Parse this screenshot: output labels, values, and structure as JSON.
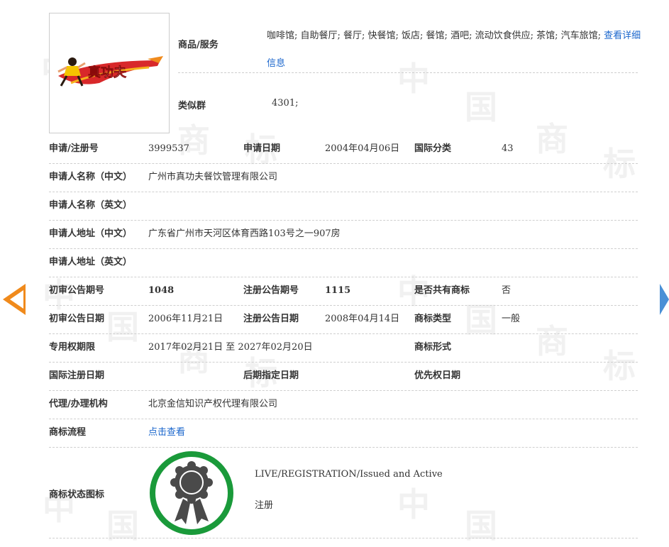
{
  "mark_image": {
    "text": "真功夫"
  },
  "goods": {
    "label": "商品/服务",
    "text": "咖啡馆; 自助餐厅; 餐厅; 快餐馆; 饭店; 餐馆; 酒吧; 流动饮食供应; 茶馆; 汽车旅馆;",
    "link": "查看详细信息"
  },
  "similar": {
    "label": "类似群",
    "value": "4301;"
  },
  "rows": {
    "reg": {
      "l1": "申请/注册号",
      "v1": "3999537",
      "l2": "申请日期",
      "v2": "2004年04月06日",
      "l3": "国际分类",
      "v3": "43"
    },
    "name_cn": {
      "l1": "申请人名称（中文）",
      "v1": "广州市真功夫餐饮管理有限公司"
    },
    "name_en": {
      "l1": "申请人名称（英文）",
      "v1": ""
    },
    "addr_cn": {
      "l1": "申请人地址（中文）",
      "v1": "广东省广州市天河区体育西路103号之一907房"
    },
    "addr_en": {
      "l1": "申请人地址（英文）",
      "v1": ""
    },
    "pub_no": {
      "l1": "初审公告期号",
      "v1": "1048",
      "l2": "注册公告期号",
      "v2": "1115",
      "l3": "是否共有商标",
      "v3": "否"
    },
    "pub_date": {
      "l1": "初审公告日期",
      "v1": "2006年11月21日",
      "l2": "注册公告日期",
      "v2": "2008年04月14日",
      "l3": "商标类型",
      "v3": "一般"
    },
    "term": {
      "l1": "专用权期限",
      "v1": "2017年02月21日 至 2027年02月20日",
      "l3": "商标形式",
      "v3": ""
    },
    "intl": {
      "l1": "国际注册日期",
      "v1": "",
      "l2": "后期指定日期",
      "v2": "",
      "l3": "优先权日期",
      "v3": ""
    },
    "agent": {
      "l1": "代理/办理机构",
      "v1": "北京金信知识产权代理有限公司"
    },
    "flow": {
      "l1": "商标流程",
      "v1": "点击查看"
    }
  },
  "status": {
    "label": "商标状态图标",
    "en": "LIVE/REGISTRATION/Issued and Active",
    "cn": "注册",
    "ring_color": "#1a9a3a",
    "icon_color": "#4a4a4a"
  },
  "watermark": [
    "中",
    "国",
    "商",
    "标"
  ],
  "colors": {
    "link": "#1a66cc",
    "prev_arrow": "#f08a1c",
    "next_arrow": "#4a90d6"
  }
}
